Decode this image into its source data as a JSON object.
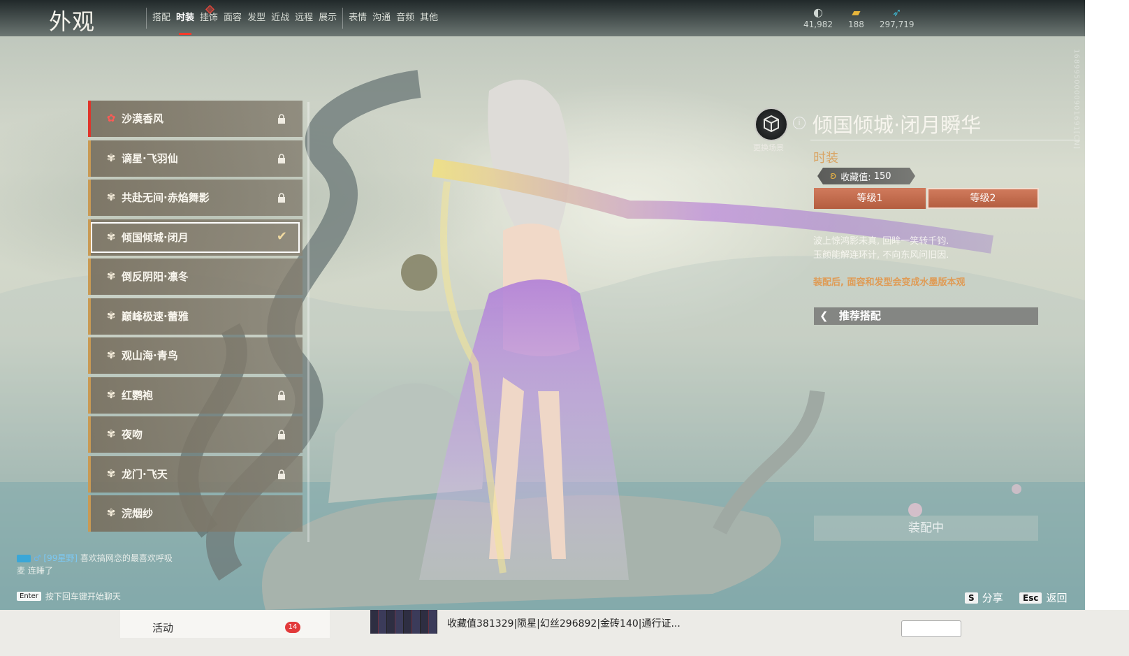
{
  "header": {
    "title": "外观",
    "tabs": [
      {
        "label": "搭配",
        "active": false
      },
      {
        "label": "时装",
        "active": true
      },
      {
        "label": "挂饰",
        "active": false,
        "badge": true
      },
      {
        "label": "面容",
        "active": false
      },
      {
        "label": "发型",
        "active": false
      },
      {
        "label": "近战",
        "active": false
      },
      {
        "label": "远程",
        "active": false
      },
      {
        "label": "展示",
        "active": false
      },
      {
        "label": "表情",
        "active": false
      },
      {
        "label": "沟通",
        "active": false
      },
      {
        "label": "音频",
        "active": false
      },
      {
        "label": "其他",
        "active": false
      }
    ]
  },
  "currencies": [
    {
      "icon": "echo-jade-icon",
      "value": "41,982"
    },
    {
      "icon": "gold-brick-icon",
      "value": "188"
    },
    {
      "icon": "feather-icon",
      "value": "297,719"
    }
  ],
  "costume_list": [
    {
      "label": "沙漠香风",
      "locked": true,
      "selected": false
    },
    {
      "label": "谪星·飞羽仙",
      "locked": true,
      "selected": false
    },
    {
      "label": "共赴无间·赤焰舞影",
      "locked": true,
      "selected": false
    },
    {
      "label": "倾国倾城·闭月",
      "locked": false,
      "selected": true
    },
    {
      "label": "倒反阴阳·凛冬",
      "locked": false,
      "selected": false
    },
    {
      "label": "巅峰极速·蕾雅",
      "locked": false,
      "selected": false
    },
    {
      "label": "观山海·青鸟",
      "locked": false,
      "selected": false
    },
    {
      "label": "红鹦袍",
      "locked": true,
      "selected": false
    },
    {
      "label": "夜吻",
      "locked": true,
      "selected": false
    },
    {
      "label": "龙门·飞天",
      "locked": true,
      "selected": false
    },
    {
      "label": "浣烟纱",
      "locked": false,
      "selected": false
    }
  ],
  "chat": {
    "sender": "[99星野]",
    "message": "喜欢搞网恋的最喜欢呼吸",
    "message_cont": "麦 连睡了",
    "key": "Enter",
    "hint": "按下回车键开始聊天"
  },
  "detail": {
    "scene_button_label": "更换场景",
    "info_icon": "i",
    "name": "倾国倾城·闭月瞬华",
    "type": "时装",
    "collect_label": "收藏值:",
    "collect_value": "150",
    "levels": [
      "等级1",
      "等级2"
    ],
    "desc_line1": "波上惊鸿影未真, 回眸一笑转千钧.",
    "desc_line2": "玉颜能解连环计, 不向东风问旧因.",
    "warning": "装配后, 面容和发型会变成水墨版本观",
    "recommend_label": "推荐搭配",
    "equip_label": "装配中"
  },
  "hotkeys": [
    {
      "key": "S",
      "label": "分享"
    },
    {
      "key": "Esc",
      "label": "返回"
    }
  ],
  "side_vertical_text": "1689950000901691[CN]",
  "bottom": {
    "activity_label": "活动",
    "activity_badge": "14",
    "stream_text": "收藏值381329|陨星|幻丝296892|金砖140|通行证..."
  },
  "colors": {
    "accent_red": "#e0342a",
    "item_border_gold": "#c99a54",
    "level_button": "#c26b4d",
    "warning_text": "#df9b55",
    "costume_type": "#d9a565"
  }
}
